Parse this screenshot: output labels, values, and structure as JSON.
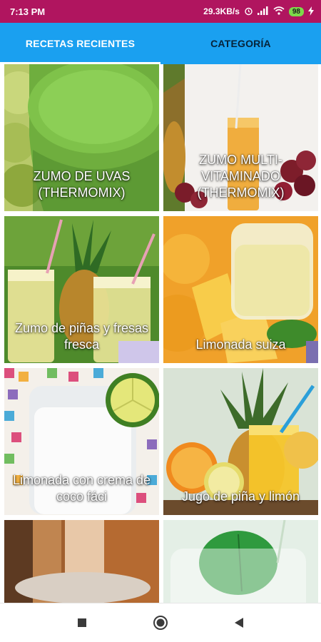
{
  "status_bar": {
    "time": "7:13 PM",
    "network_speed": "29.3KB/s",
    "battery_level": "98",
    "icons": [
      "alarm-icon",
      "signal-icon",
      "wifi-icon",
      "battery-icon",
      "charging-icon"
    ]
  },
  "tabs": [
    {
      "label": "RECETAS RECIENTES",
      "active": true
    },
    {
      "label": "CATEGORÍA",
      "active": false
    }
  ],
  "recipes": [
    {
      "title": "ZUMO DE UVAS (THERMOMIX)"
    },
    {
      "title": "ZUMO MULTI-VITAMINADO (THERMOMIX)"
    },
    {
      "title": "Zumo de piñas y fresas fresca"
    },
    {
      "title": "Limonada suiza"
    },
    {
      "title": "Limonada con crema de coco fáci"
    },
    {
      "title": "Jugo de piña y limón"
    },
    {
      "title": ""
    },
    {
      "title": ""
    }
  ],
  "nav_bar": {
    "icons": [
      "recent-apps-icon",
      "home-icon",
      "back-icon"
    ]
  },
  "colors": {
    "status_bar": "#b0155f",
    "tab_bar": "#1aa0f0",
    "active_tab_text": "#ffffff",
    "inactive_tab_text": "#06233a"
  }
}
